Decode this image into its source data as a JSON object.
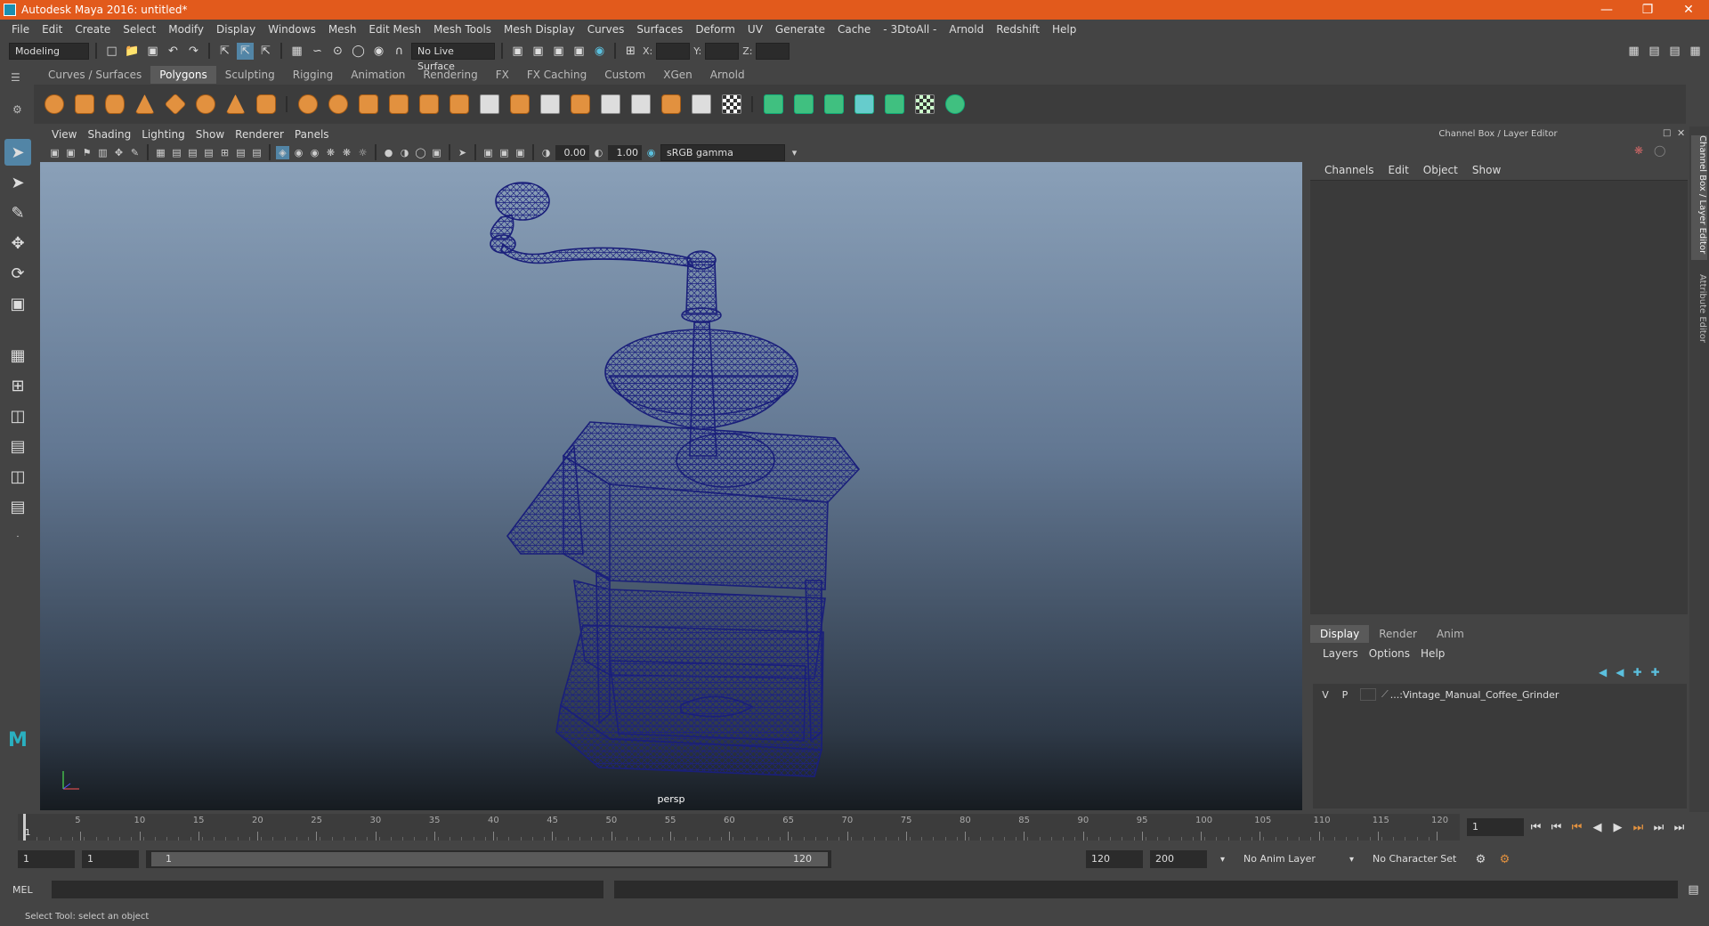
{
  "window": {
    "title": "Autodesk Maya 2016: untitled*"
  },
  "menus": [
    "File",
    "Edit",
    "Create",
    "Select",
    "Modify",
    "Display",
    "Windows",
    "Mesh",
    "Edit Mesh",
    "Mesh Tools",
    "Mesh Display",
    "Curves",
    "Surfaces",
    "Deform",
    "UV",
    "Generate",
    "Cache",
    "- 3DtoAll -",
    "Arnold",
    "Redshift",
    "Help"
  ],
  "status_line": {
    "menu_set": "Modeling",
    "live_surface": "No Live Surface",
    "x_label": "X:",
    "y_label": "Y:",
    "z_label": "Z:"
  },
  "shelf_tabs": [
    "Curves / Surfaces",
    "Polygons",
    "Sculpting",
    "Rigging",
    "Animation",
    "Rendering",
    "FX",
    "FX Caching",
    "Custom",
    "XGen",
    "Arnold"
  ],
  "active_shelf_tab": "Polygons",
  "viewport": {
    "menus": [
      "View",
      "Shading",
      "Lighting",
      "Show",
      "Renderer",
      "Panels"
    ],
    "exposure": "0.00",
    "gamma": "1.00",
    "color_space": "sRGB gamma",
    "camera_label": "persp",
    "model_color": "#1a1f7a"
  },
  "channel_box": {
    "title": "Channel Box / Layer Editor",
    "menus": [
      "Channels",
      "Edit",
      "Object",
      "Show"
    ]
  },
  "layer_editor": {
    "tabs": [
      "Display",
      "Render",
      "Anim"
    ],
    "active_tab": "Display",
    "menus": [
      "Layers",
      "Options",
      "Help"
    ],
    "layers": [
      {
        "v": "V",
        "p": "P",
        "name": "...:Vintage_Manual_Coffee_Grinder"
      }
    ]
  },
  "side_tabs": [
    "Channel Box / Layer Editor",
    "Attribute Editor"
  ],
  "timeline": {
    "ticks": [
      "5",
      "10",
      "15",
      "20",
      "25",
      "30",
      "35",
      "40",
      "45",
      "50",
      "55",
      "60",
      "65",
      "70",
      "75",
      "80",
      "85",
      "90",
      "95",
      "100",
      "105",
      "110",
      "115",
      "120"
    ],
    "current_marker": "1",
    "current_frame": "1"
  },
  "range": {
    "start": "1",
    "playback_start": "1",
    "slider_start": "1",
    "slider_end": "120",
    "playback_end": "120",
    "end": "200",
    "anim_layer": "No Anim Layer",
    "character_set": "No Character Set"
  },
  "command_line": {
    "label": "MEL"
  },
  "help_line": "Select Tool: select an object"
}
